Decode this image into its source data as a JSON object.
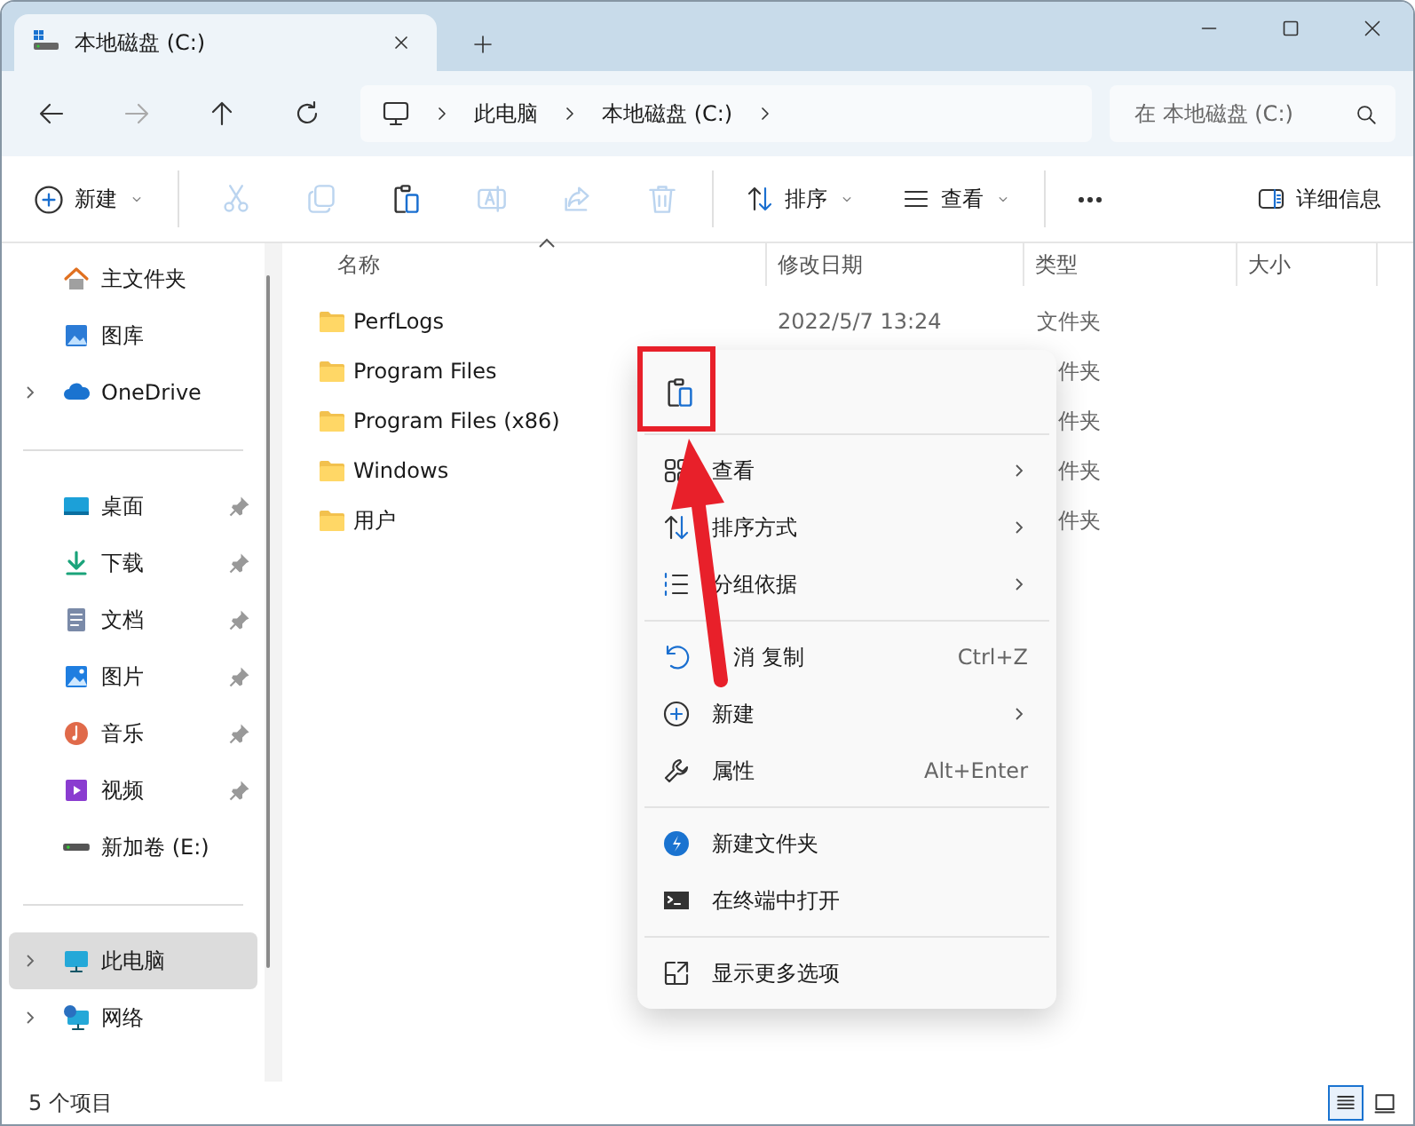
{
  "window": {
    "tab_title": "本地磁盘 (C:)"
  },
  "breadcrumb": [
    "此电脑",
    "本地磁盘 (C:)"
  ],
  "search": {
    "placeholder": "在 本地磁盘 (C:)"
  },
  "toolbar": {
    "new_label": "新建",
    "actions": [
      {
        "kind": "cut",
        "disabled": true
      },
      {
        "kind": "copy",
        "disabled": true
      },
      {
        "kind": "paste",
        "disabled": false
      },
      {
        "kind": "rename",
        "disabled": true
      },
      {
        "kind": "share",
        "disabled": true
      },
      {
        "kind": "delete",
        "disabled": true
      }
    ],
    "sort_label": "排序",
    "view_label": "查看",
    "details_label": "详细信息"
  },
  "sidebar": {
    "groups": [
      [
        {
          "label": "主文件夹",
          "expandable": false,
          "pinned": false,
          "selected": false
        },
        {
          "label": "图库",
          "expandable": false,
          "pinned": false,
          "selected": false
        },
        {
          "label": "OneDrive",
          "expandable": true,
          "pinned": false,
          "selected": false
        }
      ],
      [
        {
          "label": "桌面",
          "expandable": false,
          "pinned": true,
          "selected": false
        },
        {
          "label": "下载",
          "expandable": false,
          "pinned": true,
          "selected": false
        },
        {
          "label": "文档",
          "expandable": false,
          "pinned": true,
          "selected": false
        },
        {
          "label": "图片",
          "expandable": false,
          "pinned": true,
          "selected": false
        },
        {
          "label": "音乐",
          "expandable": false,
          "pinned": true,
          "selected": false
        },
        {
          "label": "视频",
          "expandable": false,
          "pinned": true,
          "selected": false
        },
        {
          "label": "新加卷 (E:)",
          "expandable": false,
          "pinned": false,
          "selected": false
        }
      ],
      [
        {
          "label": "此电脑",
          "expandable": true,
          "pinned": false,
          "selected": true
        },
        {
          "label": "网络",
          "expandable": true,
          "pinned": false,
          "selected": false
        }
      ]
    ]
  },
  "table": {
    "columns": [
      "名称",
      "修改日期",
      "类型",
      "大小"
    ],
    "rows": [
      {
        "name": "PerfLogs",
        "modified": "2022/5/7 13:24",
        "type": "文件夹"
      },
      {
        "name": "Program Files",
        "type": "件夹"
      },
      {
        "name": "Program Files (x86)",
        "type": "件夹"
      },
      {
        "name": "Windows",
        "type": "件夹"
      },
      {
        "name": "用户",
        "type": "件夹"
      }
    ]
  },
  "context_menu": {
    "items": [
      {
        "kind": "icon_row"
      },
      {
        "kind": "separator"
      },
      {
        "kind": "item",
        "label": "查看",
        "submenu": true
      },
      {
        "kind": "item",
        "label": "排序方式",
        "submenu": true
      },
      {
        "kind": "item",
        "label": "分组依据",
        "submenu": true
      },
      {
        "kind": "separator"
      },
      {
        "kind": "item",
        "label": "消 复制",
        "shortcut": "Ctrl+Z",
        "covered": true
      },
      {
        "kind": "item",
        "label": "新建",
        "submenu": true
      },
      {
        "kind": "item",
        "label": "属性",
        "shortcut": "Alt+Enter"
      },
      {
        "kind": "separator"
      },
      {
        "kind": "item",
        "label": "新建文件夹"
      },
      {
        "kind": "item",
        "label": "在终端中打开"
      },
      {
        "kind": "separator"
      },
      {
        "kind": "item",
        "label": "显示更多选项"
      }
    ]
  },
  "status_bar": {
    "count": "5 个项目",
    "views": [
      {
        "selected": true
      },
      {
        "selected": false
      }
    ]
  }
}
